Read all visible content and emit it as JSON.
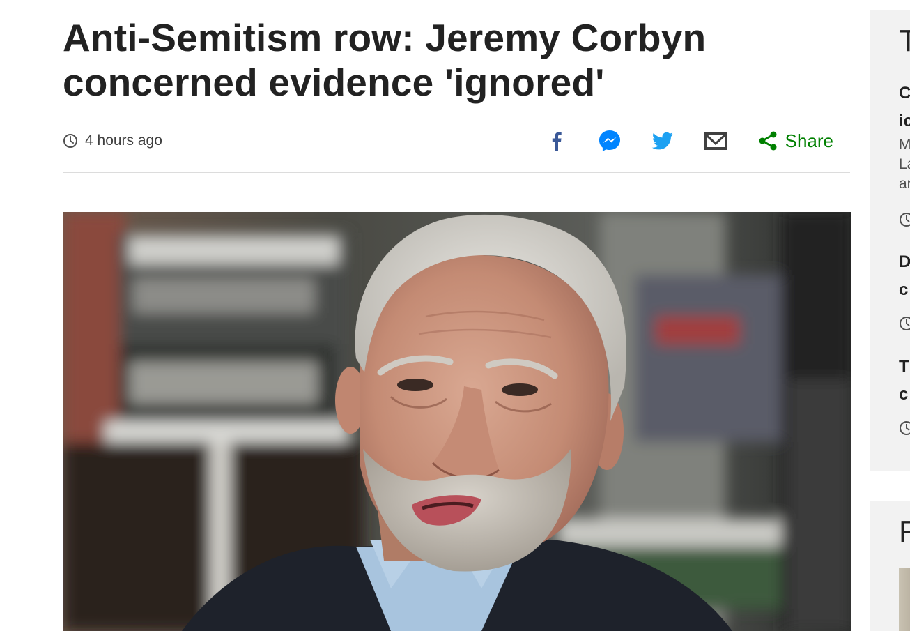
{
  "article": {
    "headline_line1": "Anti-Semitism row: Jeremy Corbyn",
    "headline_line2": "concerned evidence 'ignored'",
    "timestamp": "4 hours ago"
  },
  "share": {
    "label": "Share",
    "buttons": [
      "facebook-icon",
      "messenger-icon",
      "twitter-icon",
      "email-icon"
    ]
  },
  "colors": {
    "facebook": "#3b5998",
    "messenger": "#0084ff",
    "twitter": "#1da1f2",
    "email": "#404040",
    "share": "#008000",
    "sidebar_bg": "#f2f2f2"
  },
  "sidebar": {
    "top_panel": {
      "heading": "T",
      "items": [
        {
          "title_l1": "C",
          "title_l2": "ic",
          "summary": [
            "M",
            "La",
            "ar"
          ]
        },
        {
          "title_l1": "D",
          "title_l2": "c",
          "summary": []
        },
        {
          "title_l1": "T",
          "title_l2": "c",
          "summary": []
        }
      ]
    },
    "bottom_panel": {
      "heading": "F"
    }
  }
}
